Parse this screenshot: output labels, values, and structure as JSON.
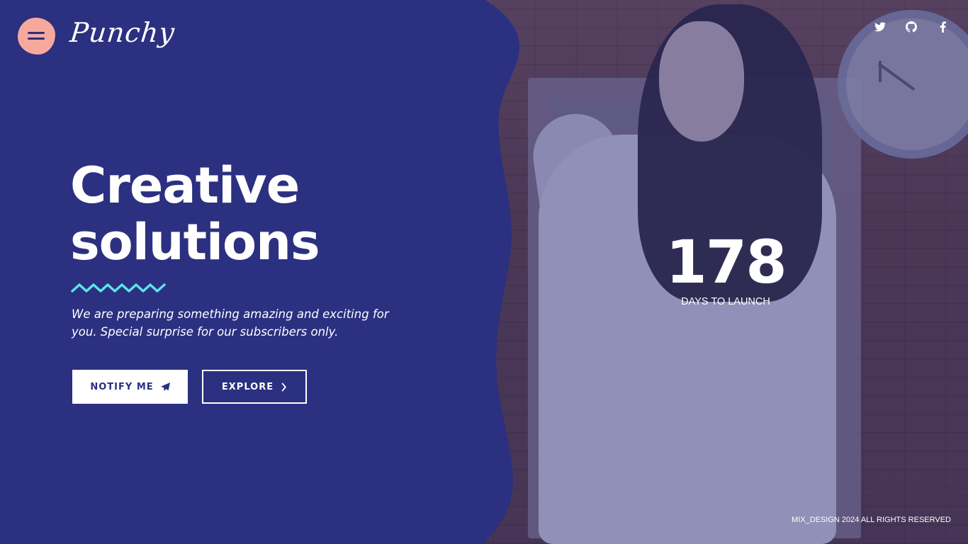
{
  "brand": {
    "logo_text": "Punchy"
  },
  "header": {
    "menu_icon": "hamburger-icon",
    "social": [
      {
        "name": "twitter",
        "icon": "twitter-icon"
      },
      {
        "name": "github",
        "icon": "github-icon"
      },
      {
        "name": "facebook",
        "icon": "facebook-icon"
      }
    ]
  },
  "hero": {
    "title_line1": "Creative",
    "title_line2": "solutions",
    "subtitle": "We are preparing something amazing and exciting for you. Special surprise for our subscribers only.",
    "notify_label": "NOTIFY ME",
    "notify_icon": "paper-plane-icon",
    "explore_label": "EXPLORE",
    "explore_icon": "chevron-right-icon"
  },
  "countdown": {
    "value": "178",
    "label": "DAYS TO LAUNCH"
  },
  "footer": {
    "copyright": "MIX_DESIGN 2024 ALL RIGHTS RESERVED"
  },
  "colors": {
    "panel_blue": "#2b3080",
    "accent_pink": "#f7a89d",
    "accent_cyan": "#5ee3ea",
    "text_white": "#ffffff"
  }
}
